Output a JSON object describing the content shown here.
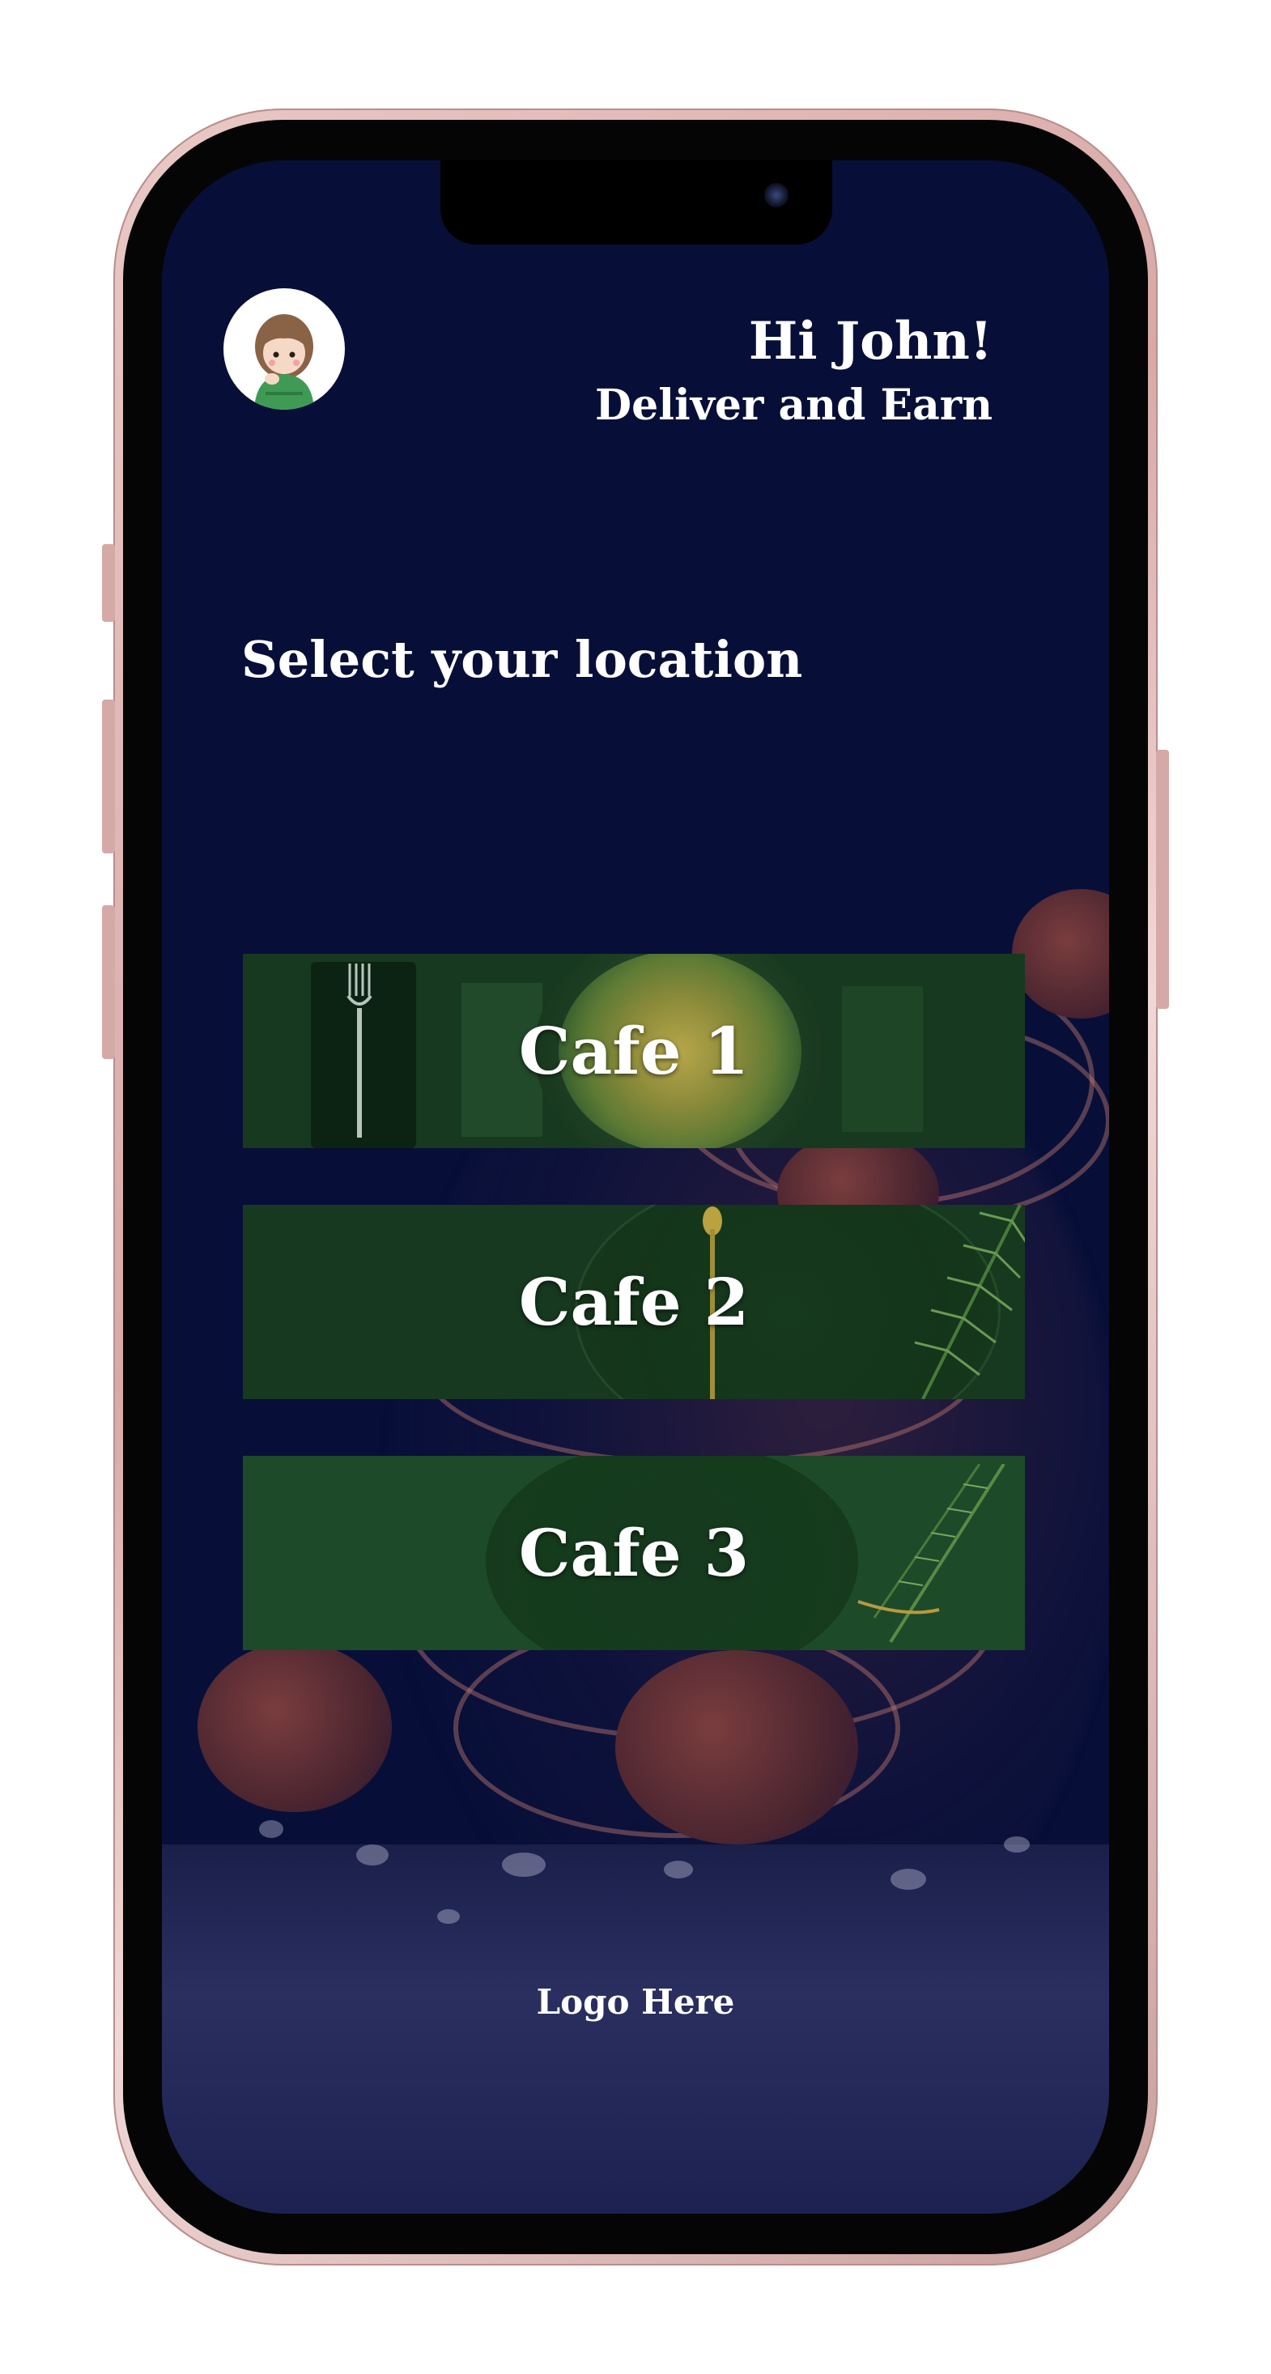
{
  "header": {
    "greeting": "Hi John!",
    "subtitle": "Deliver and Earn"
  },
  "main": {
    "section_title": "Select your location",
    "cafes": [
      {
        "label": "Cafe 1"
      },
      {
        "label": "Cafe 2"
      },
      {
        "label": "Cafe 3"
      }
    ]
  },
  "footer": {
    "logo_text": "Logo Here"
  },
  "colors": {
    "screen_background": "#070f38",
    "card_background": "#17391f",
    "text": "#ffffff",
    "phone_frame": "#e3bcb9"
  },
  "icons": {
    "avatar": "avatar-girl-icon"
  }
}
